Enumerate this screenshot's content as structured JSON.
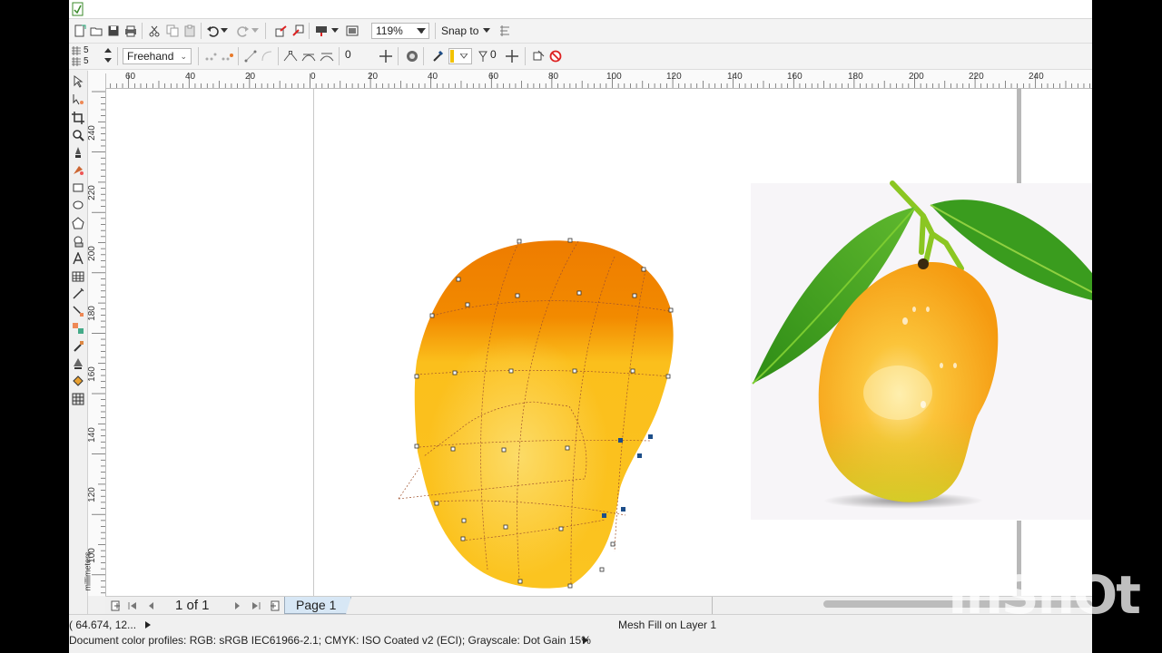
{
  "toolbar": {
    "zoom_value": "119%",
    "snap_to_label": "Snap to"
  },
  "property_bar": {
    "mesh_rows": "5",
    "mesh_cols": "5",
    "selection_mode": "Freehand",
    "smoothing_value": "0",
    "transparency_value": "0"
  },
  "rulers": {
    "units": "millimeters",
    "horizontal_ticks": [
      "60",
      "40",
      "20",
      "0",
      "20",
      "40",
      "60",
      "80",
      "100",
      "120",
      "140",
      "160",
      "180",
      "200",
      "220",
      "240"
    ],
    "vertical_ticks": [
      "240",
      "220",
      "200",
      "180",
      "160",
      "140",
      "120",
      "100"
    ]
  },
  "page_nav": {
    "page_counter": "1 of 1",
    "page_tab": "Page 1"
  },
  "status": {
    "cursor_position": "( 64.674, 12...",
    "object_info": "Mesh Fill on Layer 1",
    "color_profiles": "Document color profiles: RGB: sRGB IEC61966-2.1; CMYK: ISO Coated v2 (ECI); Grayscale: Dot Gain 15%"
  },
  "watermark": "InShOt",
  "colors": {
    "mango_top": "#ef8000",
    "mango_body": "#fbc623",
    "leaf_green": "#3a9c1e",
    "accent_blue": "#1d4e89"
  }
}
